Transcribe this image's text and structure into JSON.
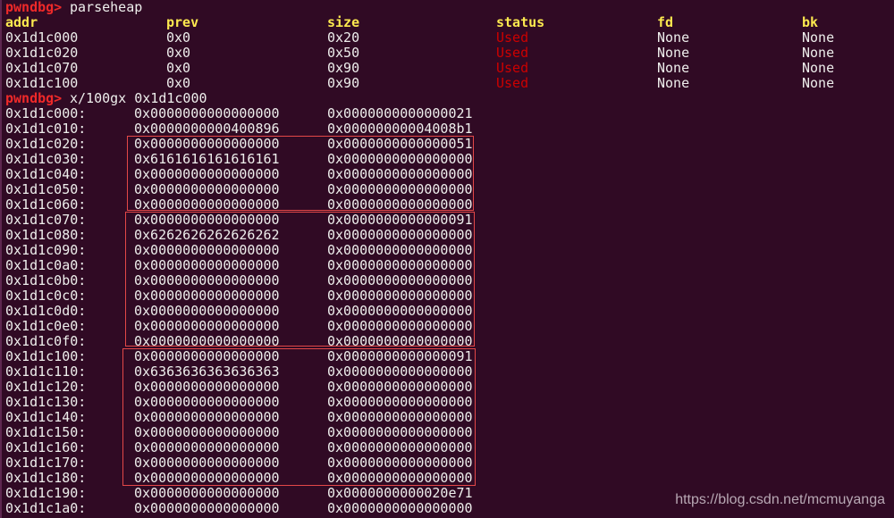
{
  "terminal": {
    "prompt": "pwndbg>",
    "command1": "parseheap",
    "command2": "x/100gx 0x1d1c000",
    "accent_colors": {
      "prompt": "#ef2929",
      "header": "#fce94f",
      "used": "#cc0000",
      "highlight_box": "#e34848"
    }
  },
  "parseheap": {
    "headers": [
      "addr",
      "prev",
      "size",
      "status",
      "fd",
      "bk"
    ],
    "rows": [
      [
        "0x1d1c000",
        "0x0",
        "0x20",
        "Used",
        "None",
        "None"
      ],
      [
        "0x1d1c020",
        "0x0",
        "0x50",
        "Used",
        "None",
        "None"
      ],
      [
        "0x1d1c070",
        "0x0",
        "0x90",
        "Used",
        "None",
        "None"
      ],
      [
        "0x1d1c100",
        "0x0",
        "0x90",
        "Used",
        "None",
        "None"
      ]
    ]
  },
  "memory": [
    [
      "0x1d1c000:",
      "0x0000000000000000",
      "0x0000000000000021"
    ],
    [
      "0x1d1c010:",
      "0x0000000000400896",
      "0x00000000004008b1"
    ],
    [
      "0x1d1c020:",
      "0x0000000000000000",
      "0x0000000000000051"
    ],
    [
      "0x1d1c030:",
      "0x6161616161616161",
      "0x0000000000000000"
    ],
    [
      "0x1d1c040:",
      "0x0000000000000000",
      "0x0000000000000000"
    ],
    [
      "0x1d1c050:",
      "0x0000000000000000",
      "0x0000000000000000"
    ],
    [
      "0x1d1c060:",
      "0x0000000000000000",
      "0x0000000000000000"
    ],
    [
      "0x1d1c070:",
      "0x0000000000000000",
      "0x0000000000000091"
    ],
    [
      "0x1d1c080:",
      "0x6262626262626262",
      "0x0000000000000000"
    ],
    [
      "0x1d1c090:",
      "0x0000000000000000",
      "0x0000000000000000"
    ],
    [
      "0x1d1c0a0:",
      "0x0000000000000000",
      "0x0000000000000000"
    ],
    [
      "0x1d1c0b0:",
      "0x0000000000000000",
      "0x0000000000000000"
    ],
    [
      "0x1d1c0c0:",
      "0x0000000000000000",
      "0x0000000000000000"
    ],
    [
      "0x1d1c0d0:",
      "0x0000000000000000",
      "0x0000000000000000"
    ],
    [
      "0x1d1c0e0:",
      "0x0000000000000000",
      "0x0000000000000000"
    ],
    [
      "0x1d1c0f0:",
      "0x0000000000000000",
      "0x0000000000000000"
    ],
    [
      "0x1d1c100:",
      "0x0000000000000000",
      "0x0000000000000091"
    ],
    [
      "0x1d1c110:",
      "0x6363636363636363",
      "0x0000000000000000"
    ],
    [
      "0x1d1c120:",
      "0x0000000000000000",
      "0x0000000000000000"
    ],
    [
      "0x1d1c130:",
      "0x0000000000000000",
      "0x0000000000000000"
    ],
    [
      "0x1d1c140:",
      "0x0000000000000000",
      "0x0000000000000000"
    ],
    [
      "0x1d1c150:",
      "0x0000000000000000",
      "0x0000000000000000"
    ],
    [
      "0x1d1c160:",
      "0x0000000000000000",
      "0x0000000000000000"
    ],
    [
      "0x1d1c170:",
      "0x0000000000000000",
      "0x0000000000000000"
    ],
    [
      "0x1d1c180:",
      "0x0000000000000000",
      "0x0000000000000000"
    ],
    [
      "0x1d1c190:",
      "0x0000000000000000",
      "0x0000000000020e71"
    ],
    [
      "0x1d1c1a0:",
      "0x0000000000000000",
      "0x0000000000000000"
    ]
  ],
  "watermark": "https://blog.csdn.net/mcmuyanga"
}
